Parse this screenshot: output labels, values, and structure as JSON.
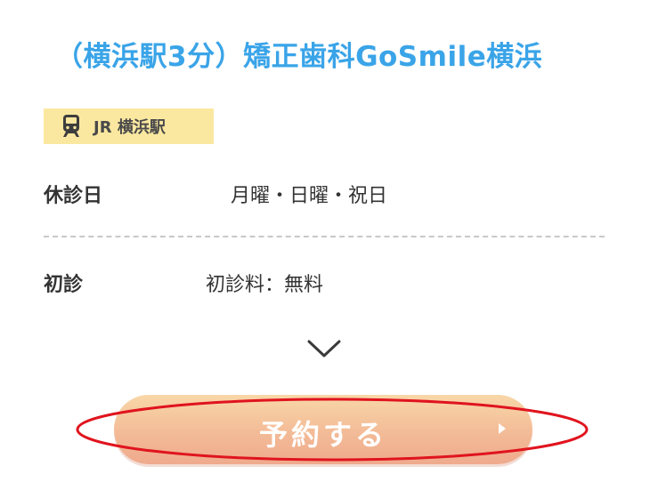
{
  "clinic": {
    "title": "（横浜駅3分）矯正歯科GoSmile横浜"
  },
  "station": {
    "icon": "train-icon",
    "label": "JR 横浜駅"
  },
  "details": {
    "holiday": {
      "label": "休診日",
      "value": "月曜・日曜・祝日"
    },
    "first_visit": {
      "label": "初診",
      "value": "初診料：無料"
    }
  },
  "expand": {
    "icon": "chevron-down-icon"
  },
  "reserve": {
    "label": "予約する",
    "icon": "caret-right-icon"
  },
  "colors": {
    "title": "#3aa4e8",
    "badge_bg": "#fbe8a0",
    "button_gradient_top": "#f8d7a8",
    "button_gradient_bottom": "#efaa8d",
    "highlight": "#e0141e"
  }
}
